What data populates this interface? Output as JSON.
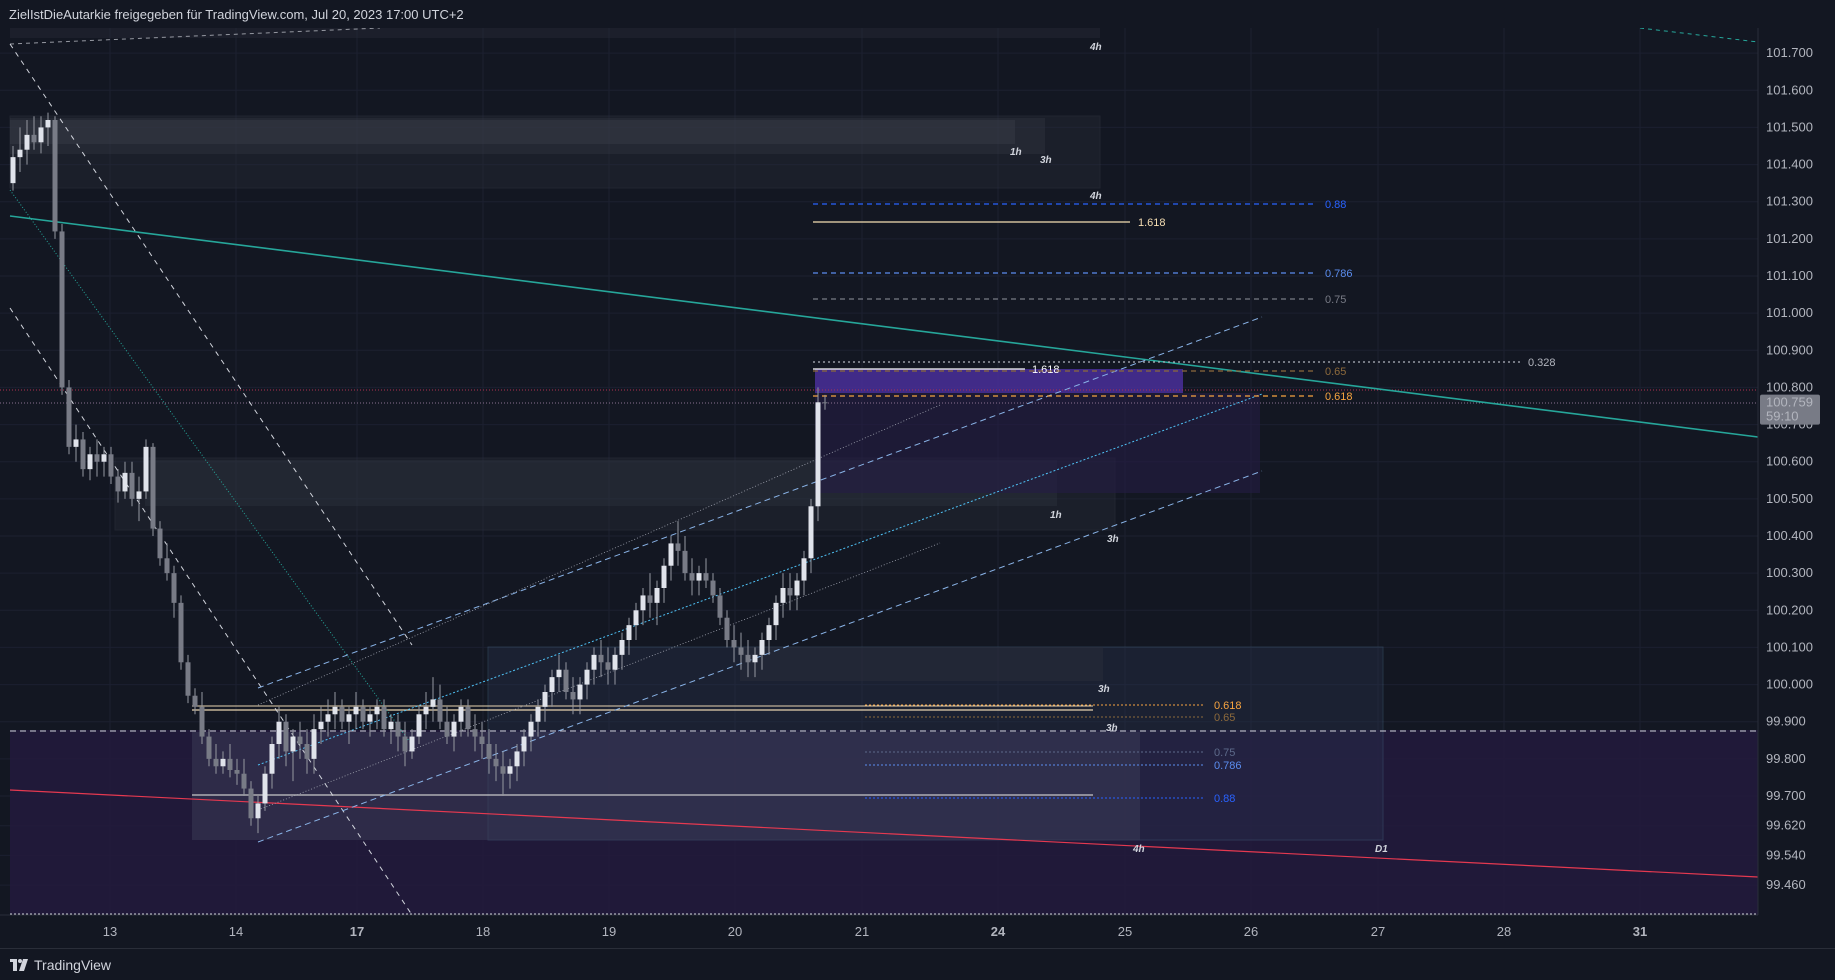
{
  "header": {
    "title": "ZielIstDieAutarkie freigegeben für TradingView.com, Jul 20, 2023 17:00 UTC+2"
  },
  "footer": {
    "brand": "TradingView"
  },
  "chart_data": {
    "type": "candlestick",
    "price_axis": {
      "ticks": [
        "101.700",
        "101.600",
        "101.500",
        "101.400",
        "101.300",
        "101.200",
        "101.100",
        "101.000",
        "100.900",
        "100.800",
        "100.700",
        "100.600",
        "100.500",
        "100.400",
        "100.300",
        "100.200",
        "100.100",
        "100.000",
        "99.900",
        "99.800",
        "99.700",
        "99.620",
        "99.540",
        "99.460"
      ],
      "current_price": "100.759",
      "countdown": "59:10",
      "range": [
        99.42,
        101.73
      ]
    },
    "time_axis": {
      "labels": [
        {
          "text": "13",
          "bold": false
        },
        {
          "text": "14",
          "bold": false
        },
        {
          "text": "17",
          "bold": true
        },
        {
          "text": "18",
          "bold": false
        },
        {
          "text": "19",
          "bold": false
        },
        {
          "text": "20",
          "bold": false
        },
        {
          "text": "21",
          "bold": false
        },
        {
          "text": "24",
          "bold": true
        },
        {
          "text": "25",
          "bold": false
        },
        {
          "text": "26",
          "bold": false
        },
        {
          "text": "27",
          "bold": false
        },
        {
          "text": "28",
          "bold": false
        },
        {
          "text": "31",
          "bold": true
        }
      ]
    },
    "zone_labels": [
      "4h",
      "1h",
      "3h",
      "4h",
      "1h",
      "3h",
      "3h",
      "3h",
      "4h",
      "D1"
    ],
    "fib_upper": [
      {
        "label": "0.88",
        "color": "#2962ff"
      },
      {
        "label": "1.618",
        "color": "#f5deb3"
      },
      {
        "label": "0.786",
        "color": "#5b8def"
      },
      {
        "label": "0.75",
        "color": "#787b86"
      },
      {
        "label": "0.328",
        "color": "#b2b5be"
      },
      {
        "label": "1.618",
        "color": "#ffffff"
      },
      {
        "label": "0.65",
        "color": "#8d6a3c"
      },
      {
        "label": "0.618",
        "color": "#f7a440"
      }
    ],
    "fib_lower": [
      {
        "label": "0.618",
        "color": "#f7a440"
      },
      {
        "label": "0.65",
        "color": "#8d6a3c"
      },
      {
        "label": "0.75",
        "color": "#5d6a8a"
      },
      {
        "label": "0.786",
        "color": "#5b8def"
      },
      {
        "label": "0.88",
        "color": "#2962ff"
      }
    ],
    "colors": {
      "background": "#131722",
      "trendline_teal": "#26a69a",
      "trendline_red": "#e53950",
      "candle": "#d1d4dc",
      "demand_zone": "#2a1f4a"
    }
  }
}
